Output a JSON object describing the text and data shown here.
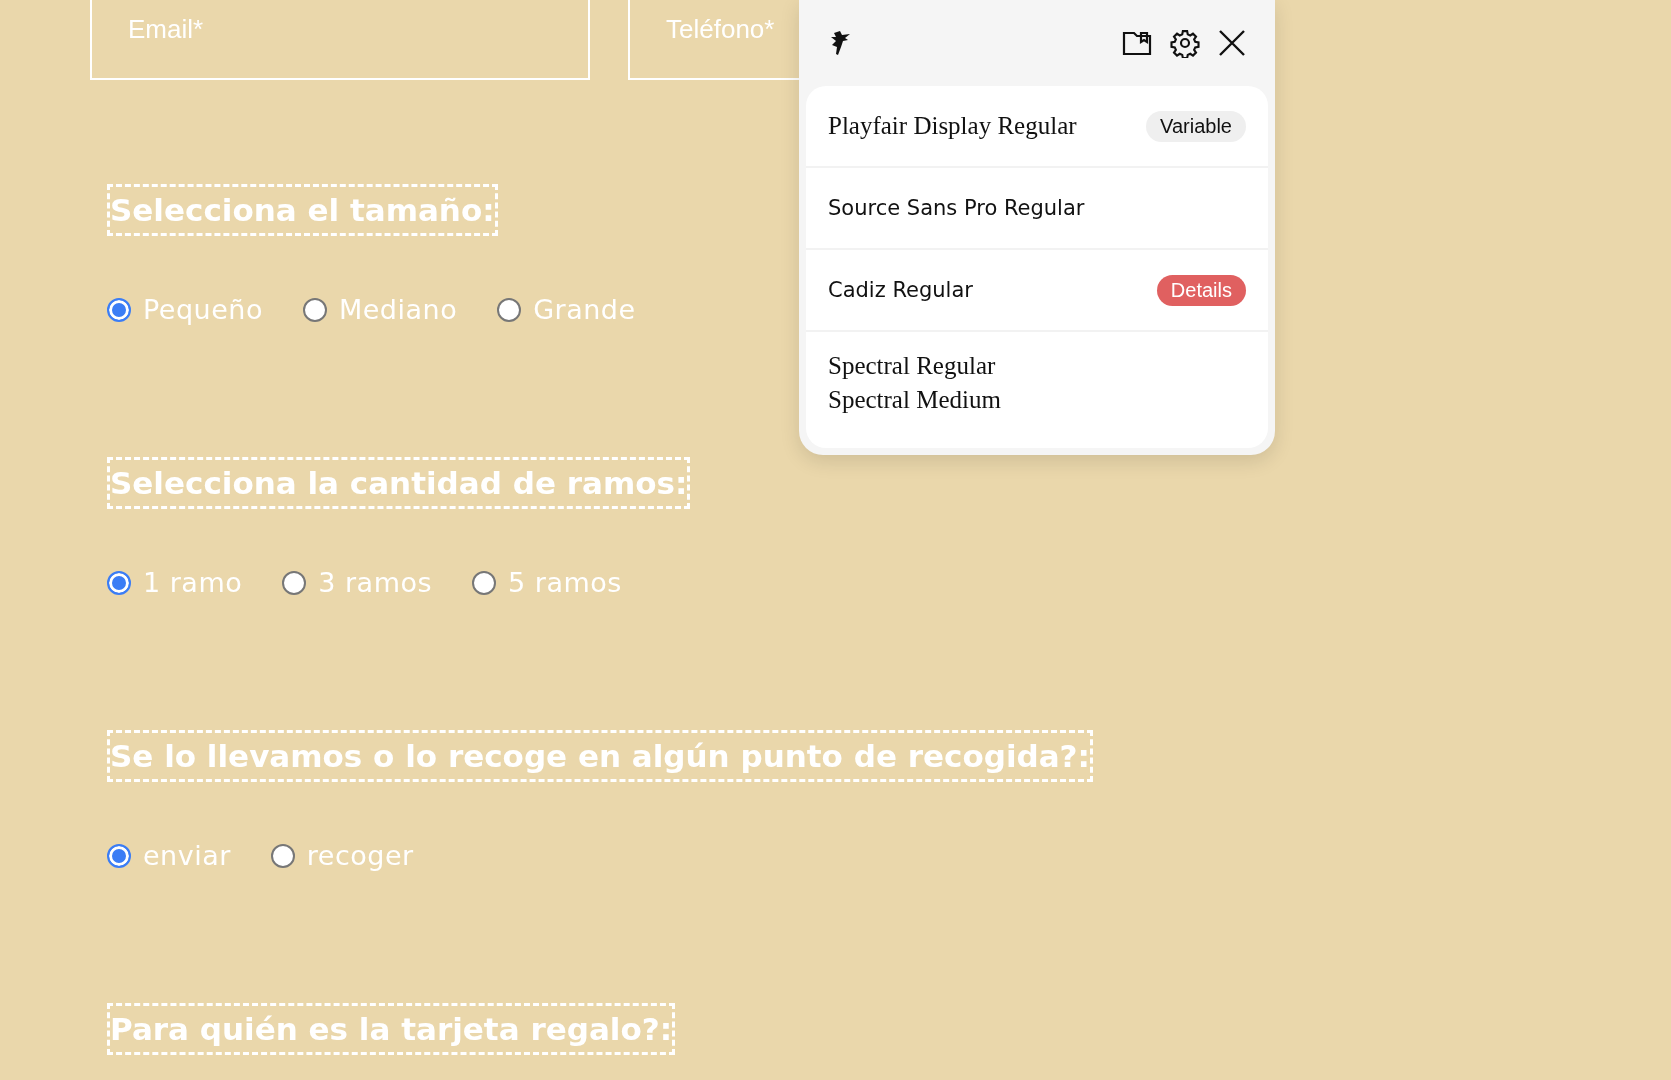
{
  "contact_fields": [
    {
      "placeholder": "Email*"
    },
    {
      "placeholder": "Teléfono*"
    }
  ],
  "questions": [
    {
      "title": "Selecciona el tamaño:",
      "options": [
        {
          "label": "Pequeño",
          "selected": true
        },
        {
          "label": "Mediano",
          "selected": false
        },
        {
          "label": "Grande",
          "selected": false
        }
      ]
    },
    {
      "title": "Selecciona la cantidad de ramos:",
      "options": [
        {
          "label": "1 ramo",
          "selected": true
        },
        {
          "label": "3 ramos",
          "selected": false
        },
        {
          "label": "5 ramos",
          "selected": false
        }
      ]
    },
    {
      "title": "Se lo llevamos o lo recoge en algún punto de recogida?:",
      "options": [
        {
          "label": "enviar",
          "selected": true
        },
        {
          "label": "recoger",
          "selected": false
        }
      ]
    },
    {
      "title": "Para quién es la tarjeta regalo?:"
    }
  ],
  "font_panel": {
    "fonts": [
      {
        "kind": "serif",
        "names": [
          "Playfair Display Regular"
        ],
        "badge": {
          "label": "Variable",
          "kind": "neutral"
        }
      },
      {
        "kind": "sans",
        "names": [
          "Source Sans Pro Regular"
        ]
      },
      {
        "kind": "sans",
        "names": [
          "Cadiz Regular"
        ],
        "badge": {
          "label": "Details",
          "kind": "alert"
        }
      },
      {
        "kind": "serif",
        "names": [
          "Spectral Regular",
          "Spectral Medium"
        ]
      }
    ]
  }
}
